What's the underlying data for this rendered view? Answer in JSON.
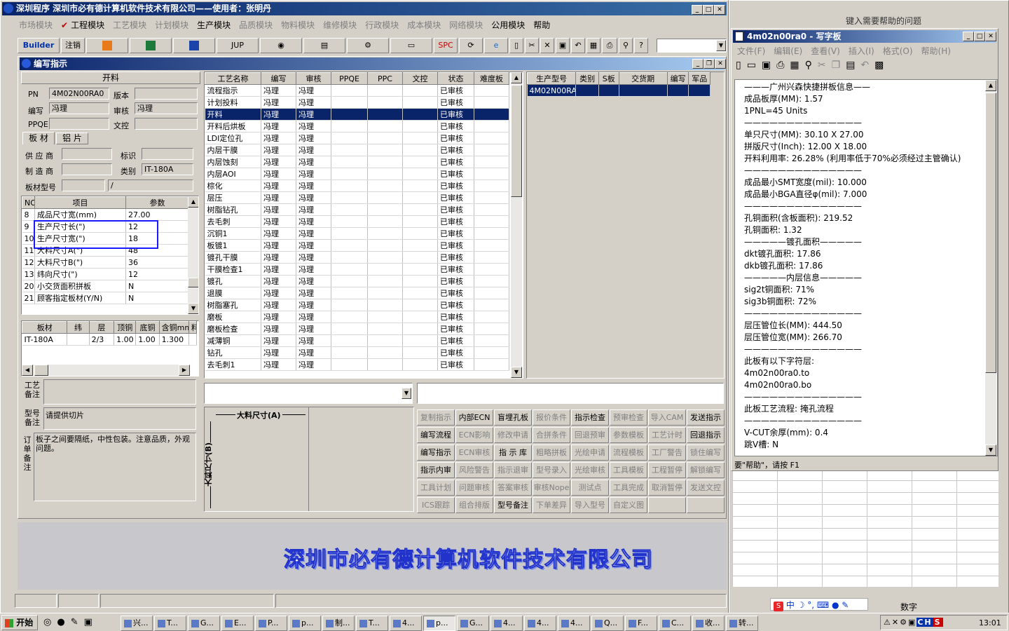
{
  "main_window": {
    "title": "深圳程序    深圳市必有德计算机软件技术有限公司——使用者：张明丹",
    "menu": [
      "市场模块",
      "工程模块",
      "工艺模块",
      "计划模块",
      "生产模块",
      "品质模块",
      "物料模块",
      "维修模块",
      "行政模块",
      "成本模块",
      "网络模块",
      "公用模块",
      "帮助"
    ],
    "menu_active": [
      "工程模块",
      "生产模块",
      "公用模块",
      "帮助"
    ],
    "toolbar": {
      "builder": "Builder",
      "logout": "注销",
      "jup": "JUP",
      "spc": "SPC"
    },
    "banner": "深圳市必有德计算机软件技术有限公司"
  },
  "child_window": {
    "title": "编写指示",
    "section_header": "开料",
    "fields": {
      "pn_label": "PN",
      "pn_value": "4M02N00RA0",
      "version_label": "版本",
      "version_value": "",
      "author_label": "编写",
      "author_value": "冯理",
      "review_label": "审核",
      "review_value": "冯理",
      "ppqe_label": "PPQE",
      "ppqe_value": "",
      "doc_label": "文控",
      "doc_value": ""
    },
    "tabs": [
      "板 材",
      "铝 片"
    ],
    "material": {
      "supplier_label": "供 应 商",
      "supplier_value": "",
      "mark_label": "标识",
      "mark_value": "",
      "maker_label": "制 造 商",
      "maker_value": "",
      "category_label": "类别",
      "category_value": "IT-180A",
      "model_label": "板材型号",
      "model_value": "",
      "model_value2": "/"
    },
    "param_table": {
      "headers": [
        "NO",
        "项目",
        "参数"
      ],
      "rows": [
        [
          "8",
          "成品尺寸宽(mm)",
          "27.00"
        ],
        [
          "9",
          "生产尺寸长(\")",
          "12"
        ],
        [
          "10",
          "生产尺寸宽(\")",
          "18"
        ],
        [
          "11",
          "大料尺寸A(\")",
          "48"
        ],
        [
          "12",
          "大料尺寸B(\")",
          "36"
        ],
        [
          "13",
          "纬向尺寸(\")",
          "12"
        ],
        [
          "20",
          "小交货面积拼板",
          "N"
        ],
        [
          "21",
          "顾客指定板材(Y/N)",
          "N"
        ]
      ]
    },
    "board_table": {
      "headers": [
        "板材",
        "纬",
        "层",
        "顶铜",
        "底铜",
        "含铜mm",
        "料"
      ],
      "rows": [
        [
          "IT-180A",
          "",
          "2/3",
          "1.00",
          "1.00",
          "1.300",
          ""
        ]
      ]
    },
    "remarks": {
      "craft_label": "工艺备注",
      "craft_value": "",
      "model_label": "型号备注",
      "model_value": "请提供切片",
      "order_label": "订单备注",
      "order_value": "板子之间要隔纸，中性包装。注意品质，外观问题。"
    },
    "process_table": {
      "headers": [
        "工艺名称",
        "编写",
        "审核",
        "PPQE",
        "PPC",
        "文控",
        "状态",
        "难度板"
      ],
      "rows": [
        [
          "流程指示",
          "冯理",
          "冯理",
          "",
          "",
          "",
          "已审核",
          ""
        ],
        [
          "计划投料",
          "冯理",
          "冯理",
          "",
          "",
          "",
          "已审核",
          ""
        ],
        [
          "开料",
          "冯理",
          "冯理",
          "",
          "",
          "",
          "已审核",
          ""
        ],
        [
          "开料后烘板",
          "冯理",
          "冯理",
          "",
          "",
          "",
          "已审核",
          ""
        ],
        [
          "LDI定位孔",
          "冯理",
          "冯理",
          "",
          "",
          "",
          "已审核",
          ""
        ],
        [
          "内层干膜",
          "冯理",
          "冯理",
          "",
          "",
          "",
          "已审核",
          ""
        ],
        [
          "内层蚀刻",
          "冯理",
          "冯理",
          "",
          "",
          "",
          "已审核",
          ""
        ],
        [
          "内层AOI",
          "冯理",
          "冯理",
          "",
          "",
          "",
          "已审核",
          ""
        ],
        [
          "棕化",
          "冯理",
          "冯理",
          "",
          "",
          "",
          "已审核",
          ""
        ],
        [
          "层压",
          "冯理",
          "冯理",
          "",
          "",
          "",
          "已审核",
          ""
        ],
        [
          "树脂钻孔",
          "冯理",
          "冯理",
          "",
          "",
          "",
          "已审核",
          ""
        ],
        [
          "去毛刺",
          "冯理",
          "冯理",
          "",
          "",
          "",
          "已审核",
          ""
        ],
        [
          "沉铜1",
          "冯理",
          "冯理",
          "",
          "",
          "",
          "已审核",
          ""
        ],
        [
          "板镀1",
          "冯理",
          "冯理",
          "",
          "",
          "",
          "已审核",
          ""
        ],
        [
          "镀孔干膜",
          "冯理",
          "冯理",
          "",
          "",
          "",
          "已审核",
          ""
        ],
        [
          "干膜检查1",
          "冯理",
          "冯理",
          "",
          "",
          "",
          "已审核",
          ""
        ],
        [
          "镀孔",
          "冯理",
          "冯理",
          "",
          "",
          "",
          "已审核",
          ""
        ],
        [
          "退膜",
          "冯理",
          "冯理",
          "",
          "",
          "",
          "已审核",
          ""
        ],
        [
          "树脂塞孔",
          "冯理",
          "冯理",
          "",
          "",
          "",
          "已审核",
          ""
        ],
        [
          "磨板",
          "冯理",
          "冯理",
          "",
          "",
          "",
          "已审核",
          ""
        ],
        [
          "磨板检查",
          "冯理",
          "冯理",
          "",
          "",
          "",
          "已审核",
          ""
        ],
        [
          "减薄铜",
          "冯理",
          "冯理",
          "",
          "",
          "",
          "已审核",
          ""
        ],
        [
          "钻孔",
          "冯理",
          "冯理",
          "",
          "",
          "",
          "已审核",
          ""
        ],
        [
          "去毛刺1",
          "冯理",
          "冯理",
          "",
          "",
          "",
          "已审核",
          ""
        ]
      ],
      "selected_index": 2
    },
    "model_table": {
      "headers": [
        "生产型号",
        "类别",
        "S板",
        "交货期",
        "编写",
        "军品"
      ],
      "rows": [
        [
          "4M02N00RA0",
          "",
          "",
          "",
          "",
          ""
        ]
      ]
    },
    "diagram": {
      "a_label": "大料尺寸(A)",
      "b_label": "大料尺寸(B)"
    },
    "action_buttons": [
      [
        "复制指示",
        "内部ECN",
        "盲埋孔板",
        "报价条件",
        "指示检查",
        "预审检查",
        "导入CAM",
        "发送指示"
      ],
      [
        "编写流程",
        "ECN影响",
        "修改申请",
        "合拼条件",
        "回退预审",
        "参数模板",
        "工艺计时",
        "回退指示"
      ],
      [
        "编写指示",
        "ECN审核",
        "指 示 库",
        "粗略拼板",
        "光绘申请",
        "流程模板",
        "工厂警告",
        "锁住编写"
      ],
      [
        "指示内审",
        "风险警告",
        "指示退审",
        "型号录入",
        "光绘审核",
        "工具模板",
        "工程暂停",
        "解锁编写"
      ],
      [
        "工具计划",
        "问题审核",
        "答案审核",
        "审核Nope",
        "测试点",
        "工具完成",
        "取消暂停",
        "发送文控"
      ],
      [
        "ICS跟踪",
        "组合排版",
        "型号备注",
        "下单差异",
        "导入型号",
        "自定义图",
        "",
        ""
      ]
    ],
    "action_enabled": [
      "内部ECN",
      "盲埋孔板",
      "指示检查",
      "发送指示",
      "编写流程",
      "回退指示",
      "编写指示",
      "指 示 库",
      "指示内审",
      "型号备注"
    ]
  },
  "wordpad": {
    "title": "4m02n00ra0 - 写字板",
    "menu": [
      "文件(F)",
      "编辑(E)",
      "查看(V)",
      "插入(I)",
      "格式(O)",
      "帮助(H)"
    ],
    "status": "要\"帮助\"，请按 F1",
    "lines": [
      "———广州兴森快捷拼板信息——",
      "成品板厚(MM): 1.57",
      "1PNL=45 Units",
      "——————————————",
      "单只尺寸(MM): 30.10 X 27.00",
      "拼版尺寸(Inch): 12.00 X 18.00",
      "开料利用率: 26.28% (利用率低于70%必须经过主管确认)",
      "——————————————",
      "成品最小SMT宽度(mil): 10.000",
      "成品最小BGA直径φ(mil): 7.000",
      "——————————————",
      "孔铜面积(含板面积): 219.52",
      "孔铜面积: 1.32",
      "—————镀孔面积—————",
      "dkt镀孔面积: 17.86",
      "dkb镀孔面积: 17.86",
      "",
      "—————内层信息—————",
      "sig2t铜面积: 71%",
      "sig3b铜面积: 72%",
      "——————————————",
      "层压管位长(MM): 444.50",
      "层压管位宽(MM): 266.70",
      "——————————————",
      "此板有以下字符层:",
      "4m02n00ra0.to",
      "4m02n00ra0.bo",
      "——————————————",
      "此板工艺流程: 掩孔流程",
      "——————————————",
      "V-CUT余厚(mm): 0.4",
      "跳V槽: N"
    ]
  },
  "excel": {
    "help_placeholder": "键入需要帮助的问题",
    "status_right": "数字"
  },
  "taskbar": {
    "start": "开始",
    "items": [
      "兴...",
      "T...",
      "G...",
      "E...",
      "P...",
      "p...",
      "制...",
      "T...",
      "4...",
      "p...",
      "G...",
      "4...",
      "4...",
      "4...",
      "Q...",
      "F...",
      "C...",
      "收...",
      "转..."
    ],
    "clock": "13:01",
    "ime": "中"
  },
  "colors": {
    "titlebar": "#0a246a",
    "face": "#d4d0c8",
    "highlight": "#0a246a",
    "banner": "#2233cc"
  }
}
